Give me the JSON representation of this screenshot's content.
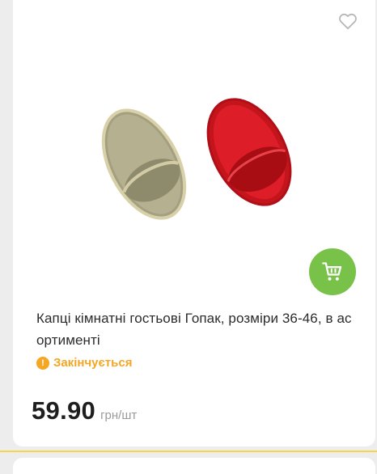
{
  "product": {
    "title": "Капці кімнатні гостьові Гопак, розміри 36-46, в асортименті",
    "status_text": "Закінчується",
    "price": "59.90",
    "unit": "грн/шт",
    "icons": {
      "favorite": "heart-icon",
      "cart": "cart-icon",
      "status": "exclamation-icon"
    }
  },
  "colors": {
    "accent_green": "#78c24a",
    "status_orange": "#f5a623",
    "divider_yellow": "#f6d34a"
  }
}
